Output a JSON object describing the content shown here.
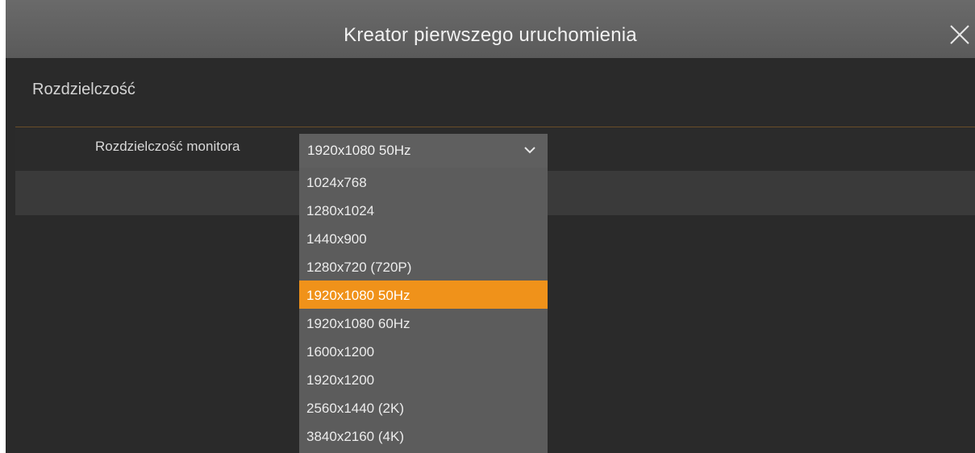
{
  "window": {
    "title": "Kreator pierwszego uruchomienia",
    "close_icon": "close-icon"
  },
  "section": {
    "title": "Rozdzielczość"
  },
  "monitor_resolution": {
    "label": "Rozdzielczość monitora",
    "selected": "1920x1080 50Hz",
    "chevron_icon": "chevron-down-icon",
    "options": [
      "1024x768",
      "1280x1024",
      "1440x900",
      "1280x720 (720P)",
      "1920x1080 50Hz",
      "1920x1080 60Hz",
      "1600x1200",
      "1920x1200",
      "2560x1440 (2K)",
      "3840x2160 (4K)"
    ],
    "selected_index": 4
  },
  "colors": {
    "accent": "#f0921a",
    "titlebar": "#646464",
    "background": "#2a2a2a",
    "dropdown": "#5c5c5c"
  }
}
